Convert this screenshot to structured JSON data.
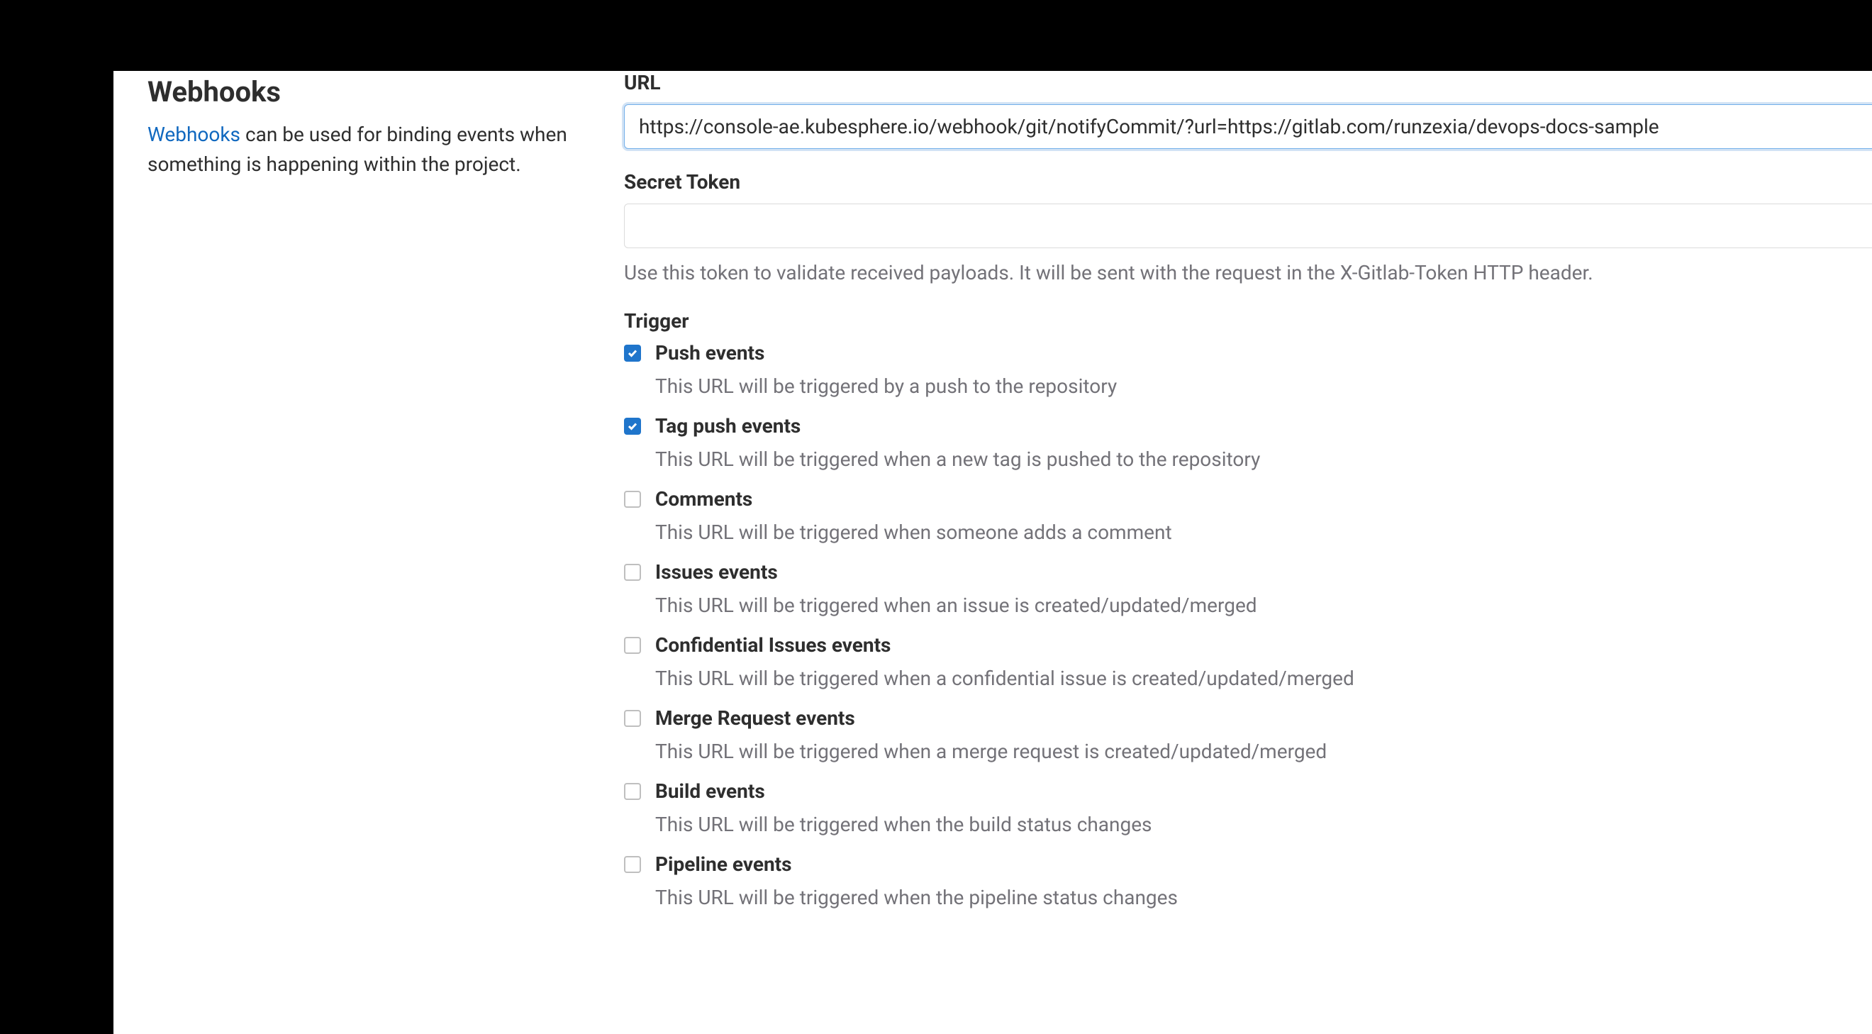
{
  "sidebar": {
    "title": "Webhooks",
    "link_text": "Webhooks",
    "desc_rest": " can be used for binding events when something is happening within the project."
  },
  "form": {
    "url_label": "URL",
    "url_value": "https://console-ae.kubesphere.io/webhook/git/notifyCommit/?url=https://gitlab.com/runzexia/devops-docs-sample",
    "secret_label": "Secret Token",
    "secret_value": "",
    "secret_help": "Use this token to validate received payloads. It will be sent with the request in the X-Gitlab-Token HTTP header.",
    "trigger_label": "Trigger",
    "triggers": [
      {
        "name": "Push events",
        "desc": "This URL will be triggered by a push to the repository",
        "checked": true
      },
      {
        "name": "Tag push events",
        "desc": "This URL will be triggered when a new tag is pushed to the repository",
        "checked": true
      },
      {
        "name": "Comments",
        "desc": "This URL will be triggered when someone adds a comment",
        "checked": false
      },
      {
        "name": "Issues events",
        "desc": "This URL will be triggered when an issue is created/updated/merged",
        "checked": false
      },
      {
        "name": "Confidential Issues events",
        "desc": "This URL will be triggered when a confidential issue is created/updated/merged",
        "checked": false
      },
      {
        "name": "Merge Request events",
        "desc": "This URL will be triggered when a merge request is created/updated/merged",
        "checked": false
      },
      {
        "name": "Build events",
        "desc": "This URL will be triggered when the build status changes",
        "checked": false
      },
      {
        "name": "Pipeline events",
        "desc": "This URL will be triggered when the pipeline status changes",
        "checked": false
      }
    ]
  }
}
